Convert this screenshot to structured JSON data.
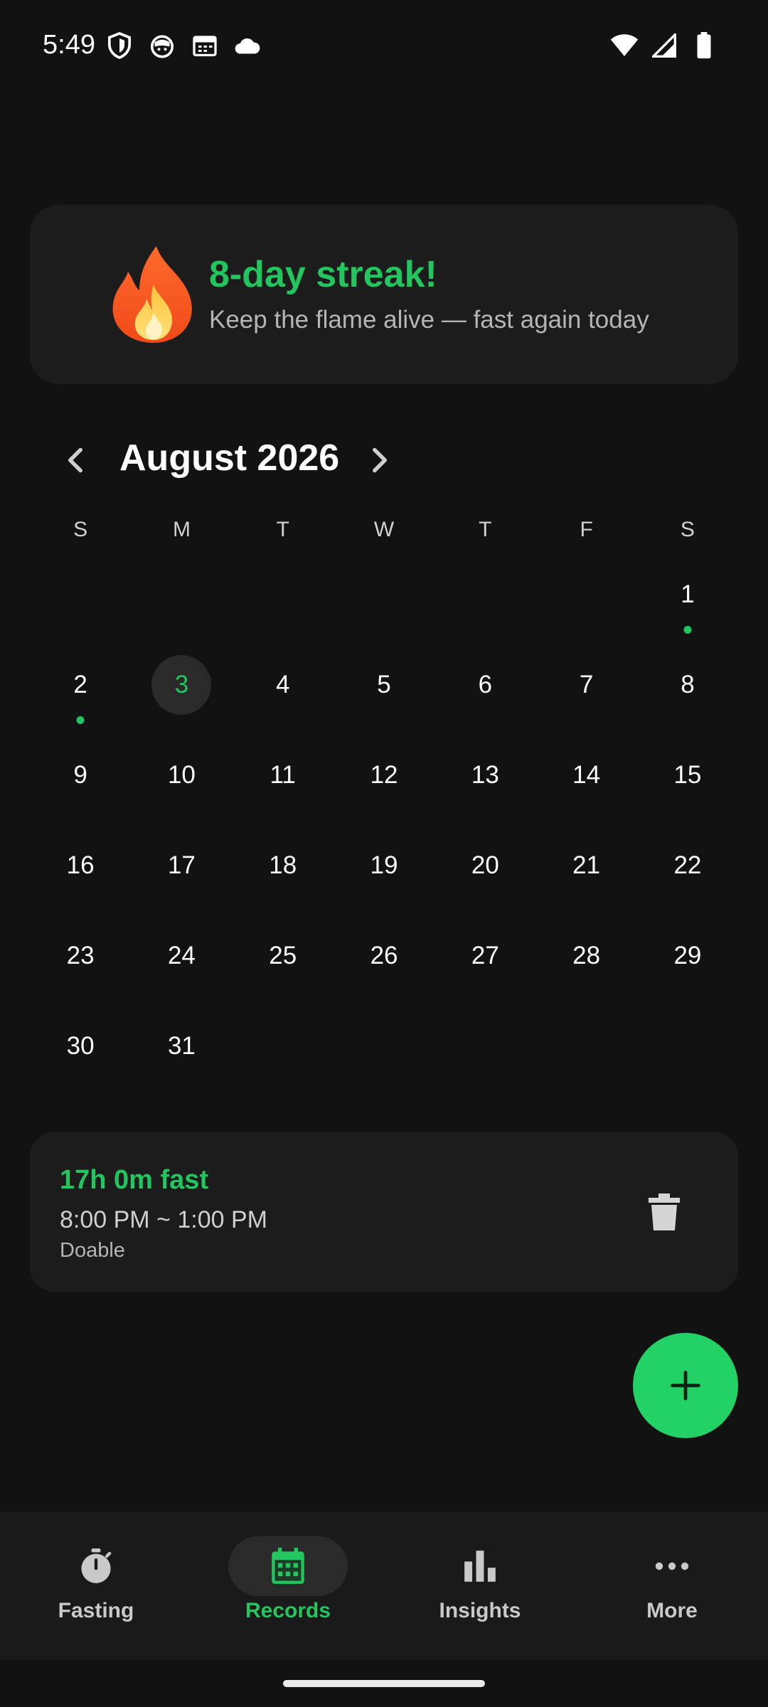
{
  "status_bar": {
    "time": "5:49"
  },
  "streak": {
    "title": "8-day streak!",
    "subtitle": "Keep the flame alive — fast again today"
  },
  "calendar": {
    "month_label": "August 2026",
    "weekdays": [
      "S",
      "M",
      "T",
      "W",
      "T",
      "F",
      "S"
    ],
    "selected_day": "3",
    "days_with_records": [
      "1",
      "2"
    ]
  },
  "record": {
    "title": "17h 0m fast",
    "time_range": "8:00 PM ~ 1:00 PM",
    "note": "Doable"
  },
  "nav": {
    "items": [
      {
        "label": "Fasting",
        "icon": "timer-icon"
      },
      {
        "label": "Records",
        "icon": "calendar-icon"
      },
      {
        "label": "Insights",
        "icon": "bar-chart-icon"
      },
      {
        "label": "More",
        "icon": "more-horiz-icon"
      }
    ],
    "active_index": 1
  },
  "colors": {
    "accent": "#22c55e",
    "background": "#121212",
    "card": "#1c1c1c"
  }
}
